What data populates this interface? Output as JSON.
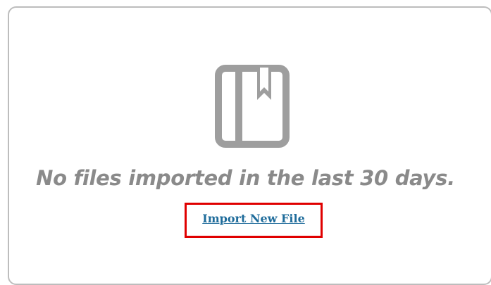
{
  "empty_state": {
    "icon": "book-icon",
    "message": "No files imported in the last 30 days.",
    "action_label": "Import New File"
  },
  "colors": {
    "icon": "#9e9e9e",
    "message": "#8a8a8a",
    "link": "#1f6c9b",
    "highlight": "#e00000",
    "card_border": "#bdbdbd"
  }
}
